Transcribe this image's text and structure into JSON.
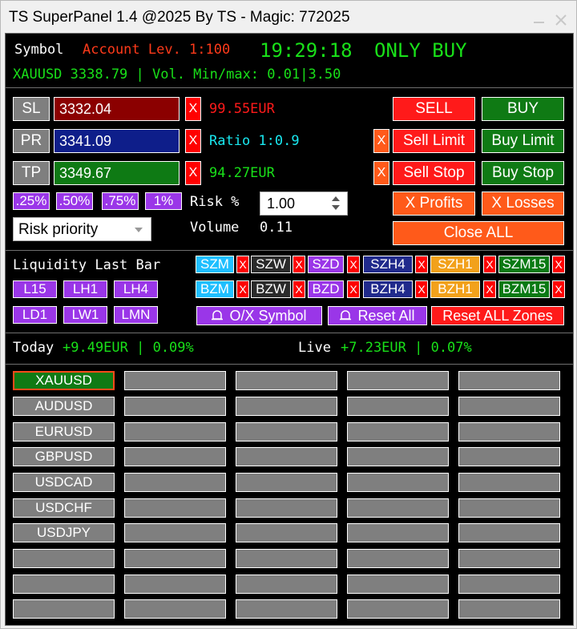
{
  "window": {
    "title": "TS SuperPanel 1.4 @2025 By TS - Magic: 772025"
  },
  "header": {
    "symbol_label": "Symbol",
    "account_label": "Account Lev. 1:100",
    "time": "19:29:18",
    "mode": "ONLY BUY",
    "info_line": "XAUUSD 3338.79 | Vol. Min/max: 0.01|3.50"
  },
  "trade": {
    "sl": {
      "label": "SL",
      "value": "3332.04",
      "info": "99.55EUR"
    },
    "pr": {
      "label": "PR",
      "value": "3341.09",
      "info": "Ratio 1:0.9"
    },
    "tp": {
      "label": "TP",
      "value": "3349.67",
      "info": "94.27EUR"
    },
    "x_label": "X",
    "pct_buttons": [
      ".25%",
      ".50%",
      ".75%",
      "1%"
    ],
    "risk_label": "Risk %",
    "risk_value": "1.00",
    "volume_label": "Volume",
    "volume_value": "0.11",
    "priority_select": "Risk priority"
  },
  "actions": {
    "sell": "SELL",
    "buy": "BUY",
    "sell_limit": "Sell Limit",
    "buy_limit": "Buy Limit",
    "sell_stop": "Sell Stop",
    "buy_stop": "Buy Stop",
    "x_profits": "X Profits",
    "x_losses": "X Losses",
    "close_all": "Close ALL"
  },
  "liquidity": {
    "title": "Liquidity Last Bar",
    "row1": [
      "L15",
      "LH1",
      "LH4"
    ],
    "row2": [
      "LD1",
      "LW1",
      "LMN"
    ]
  },
  "zones": {
    "sell_row": [
      "SZM",
      "SZW",
      "SZD",
      "SZH4",
      "SZH1",
      "SZM15"
    ],
    "buy_row": [
      "BZM",
      "BZW",
      "BZD",
      "BZH4",
      "BZH1",
      "BZM15"
    ],
    "ox_symbol": "O/X Symbol",
    "reset_all": "Reset All",
    "reset_all_zones": "Reset ALL Zones",
    "colors": {
      "m": "#1fbfff",
      "w": "#2a2a2a",
      "d": "#9a36e8",
      "h4": "#202a8c",
      "h1": "#f2a11b",
      "m15": "#0a7a14"
    }
  },
  "stats": {
    "today_label": "Today",
    "today_value": "+9.49EUR | 0.09%",
    "live_label": "Live",
    "live_value": "+7.23EUR | 0.07%"
  },
  "symbols": [
    "XAUUSD",
    "AUDUSD",
    "EURUSD",
    "GBPUSD",
    "USDCAD",
    "USDCHF",
    "USDJPY"
  ]
}
